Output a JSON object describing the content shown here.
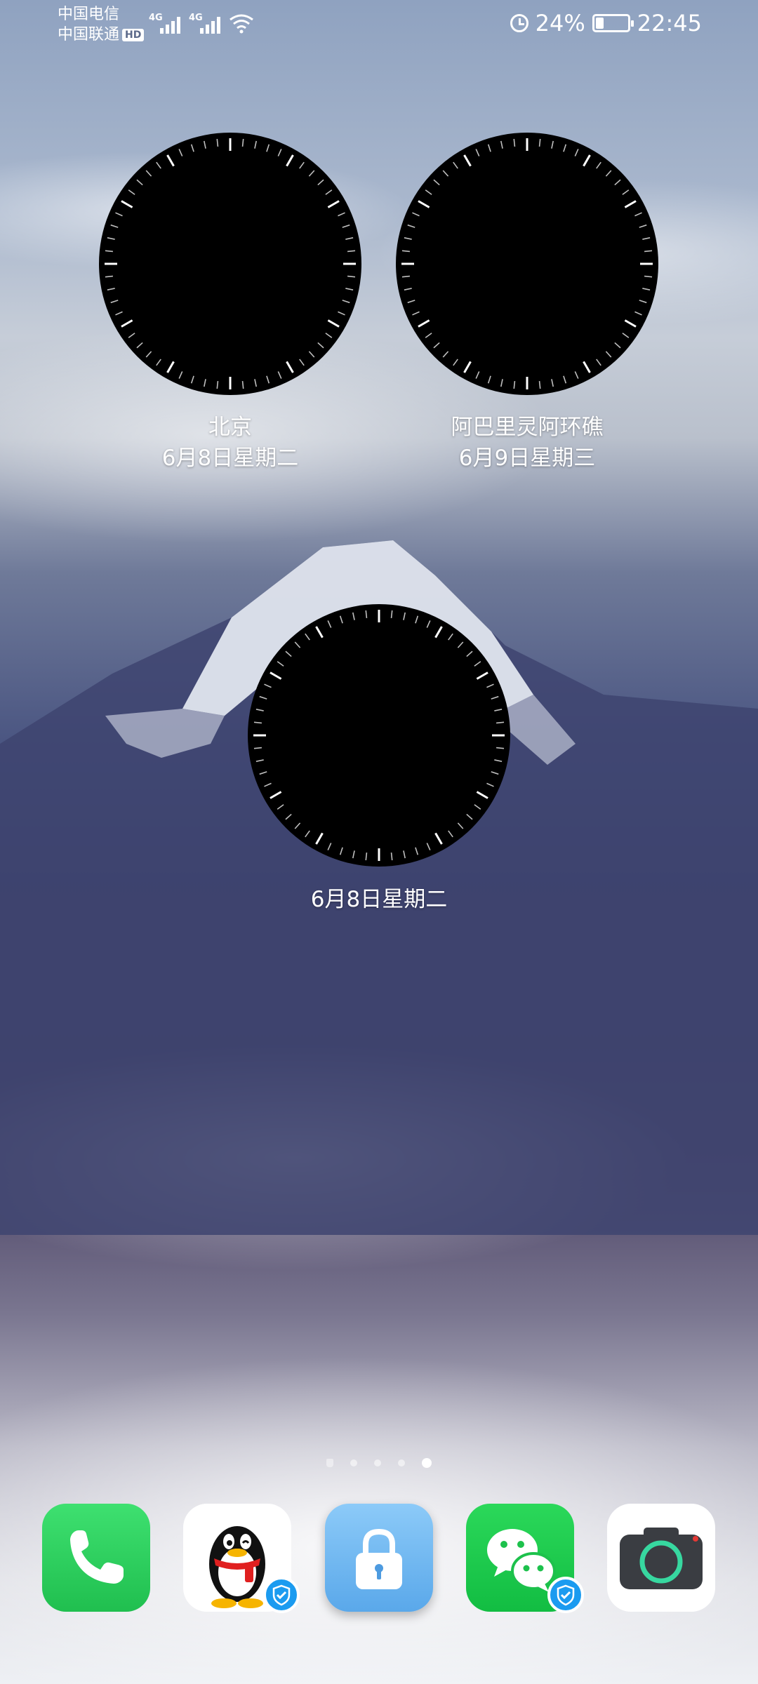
{
  "status_bar": {
    "carrier1": "中国电信",
    "carrier2": "中国联通",
    "hd_badge": "HD",
    "network1": "4G",
    "network2": "4G",
    "battery_percent": "24%",
    "battery_level": 0.24,
    "time": "22:45"
  },
  "clocks": [
    {
      "city": "北京",
      "date": "6月8日星期二"
    },
    {
      "city": "阿巴里灵阿环礁",
      "date": "6月9日星期三"
    },
    {
      "date": "6月8日星期二"
    }
  ],
  "page_indicator": {
    "count": 5,
    "active_index": 4
  },
  "dock": {
    "apps": [
      {
        "icon": "phone-icon",
        "color": "#2fcf5a"
      },
      {
        "icon": "qq-penguin-icon",
        "color": "#ffffff"
      },
      {
        "icon": "lock-icon",
        "color": "#6ab8f5"
      },
      {
        "icon": "wechat-icon",
        "color": "#1fc74a"
      },
      {
        "icon": "camera-icon",
        "color": "#ffffff"
      }
    ]
  },
  "colors": {
    "clock_face": "#000000",
    "verified_badge": "#1b9bf0"
  }
}
